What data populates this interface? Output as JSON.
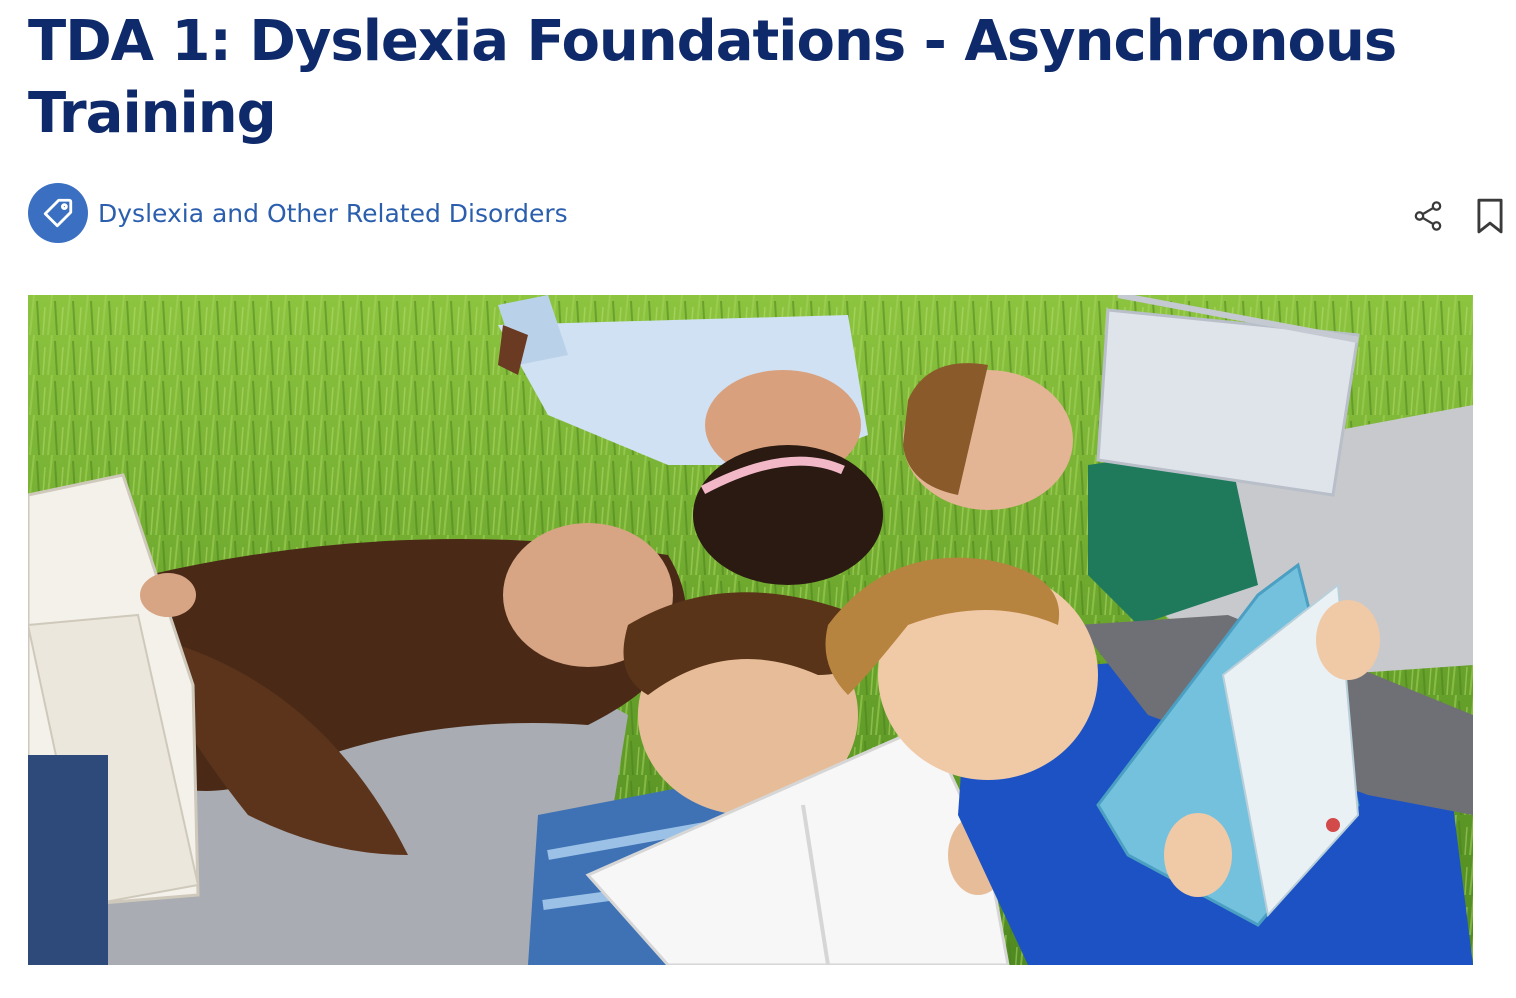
{
  "page": {
    "title": "TDA 1: Dyslexia Foundations - Asynchronous Training"
  },
  "tag": {
    "label": "Dyslexia and Other Related Disorders",
    "icon": "tag-icon"
  },
  "actions": {
    "share_icon": "share-icon",
    "bookmark_icon": "bookmark-icon"
  },
  "hero": {
    "alt": "Children lying on the grass reading books"
  },
  "colors": {
    "title": "#0f2a6b",
    "accent": "#3a6fc2",
    "link": "#2b5fae"
  }
}
